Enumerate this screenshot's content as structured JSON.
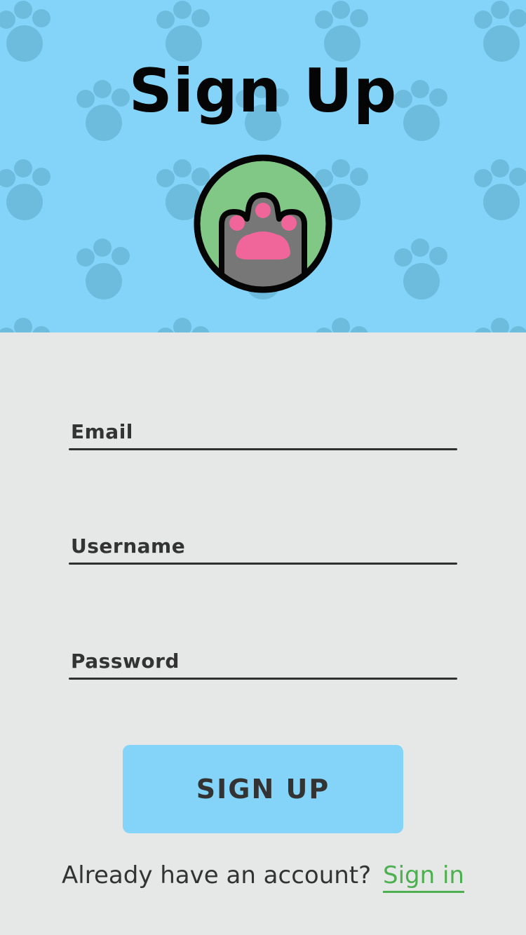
{
  "header": {
    "title": "Sign Up",
    "background_color": "#83d4f8",
    "pattern_icon": "paw-print-icon",
    "avatar_icon": "cat-paw-icon"
  },
  "form": {
    "email_label": "Email",
    "username_label": "Username",
    "password_label": "Password"
  },
  "actions": {
    "signup_label": "SIGN UP"
  },
  "footer": {
    "prompt": "Already have an account?",
    "signin_label": "Sign in",
    "link_color": "#4caf50"
  }
}
